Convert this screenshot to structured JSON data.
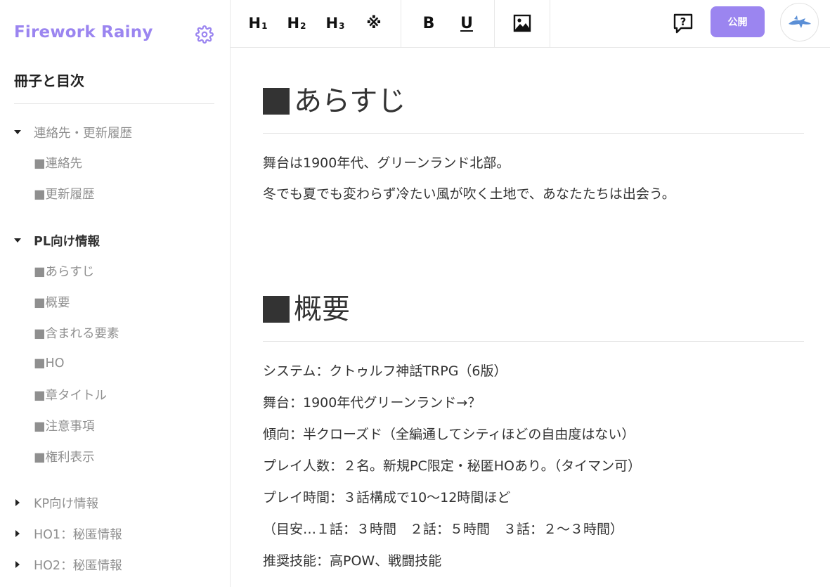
{
  "brand": {
    "name": "Firework Rainy"
  },
  "sidebar": {
    "title": "冊子と目次",
    "groups": [
      {
        "label": "連絡先・更新履歴",
        "expanded": true,
        "children": [
          "■連絡先",
          "■更新履歴"
        ]
      },
      {
        "label": "PL向け情報",
        "expanded": true,
        "active": true,
        "children": [
          "■あらすじ",
          "■概要",
          "■含まれる要素",
          "■HO",
          "■章タイトル",
          "■注意事項",
          "■権利表示"
        ]
      },
      {
        "label": "KP向け情報",
        "expanded": false
      },
      {
        "label": "HO1：秘匿情報",
        "expanded": false
      },
      {
        "label": "HO2：秘匿情報",
        "expanded": false
      }
    ]
  },
  "toolbar": {
    "h1": "H",
    "h1_sub": "1",
    "h2": "H",
    "h2_sub": "2",
    "h3": "H",
    "h3_sub": "3",
    "kome": "※",
    "bold": "B",
    "underline": "U",
    "publish": "公開"
  },
  "main": {
    "sections": [
      {
        "heading": "あらすじ",
        "lines": [
          "舞台は1900年代、グリーンランド北部。",
          "冬でも夏でも変わらず冷たい風が吹く土地で、あなたたちは出会う。"
        ]
      },
      {
        "heading": "概要",
        "lines": [
          "システム：クトゥルフ神話TRPG（6版）",
          "舞台：1900年代グリーンランド→？",
          "傾向：半クローズド（全編通してシティほどの自由度はない）",
          "プレイ人数：２名。新規PC限定・秘匿HOあり。（タイマン可）",
          "プレイ時間：３話構成で10〜12時間ほど",
          "（目安…１話：３時間　２話：５時間　３話：２〜３時間）",
          "推奨技能：高POW、戦闘技能"
        ]
      }
    ]
  },
  "colors": {
    "accent": "#9b85f0",
    "text": "#333333",
    "muted": "#8f8f8f"
  }
}
